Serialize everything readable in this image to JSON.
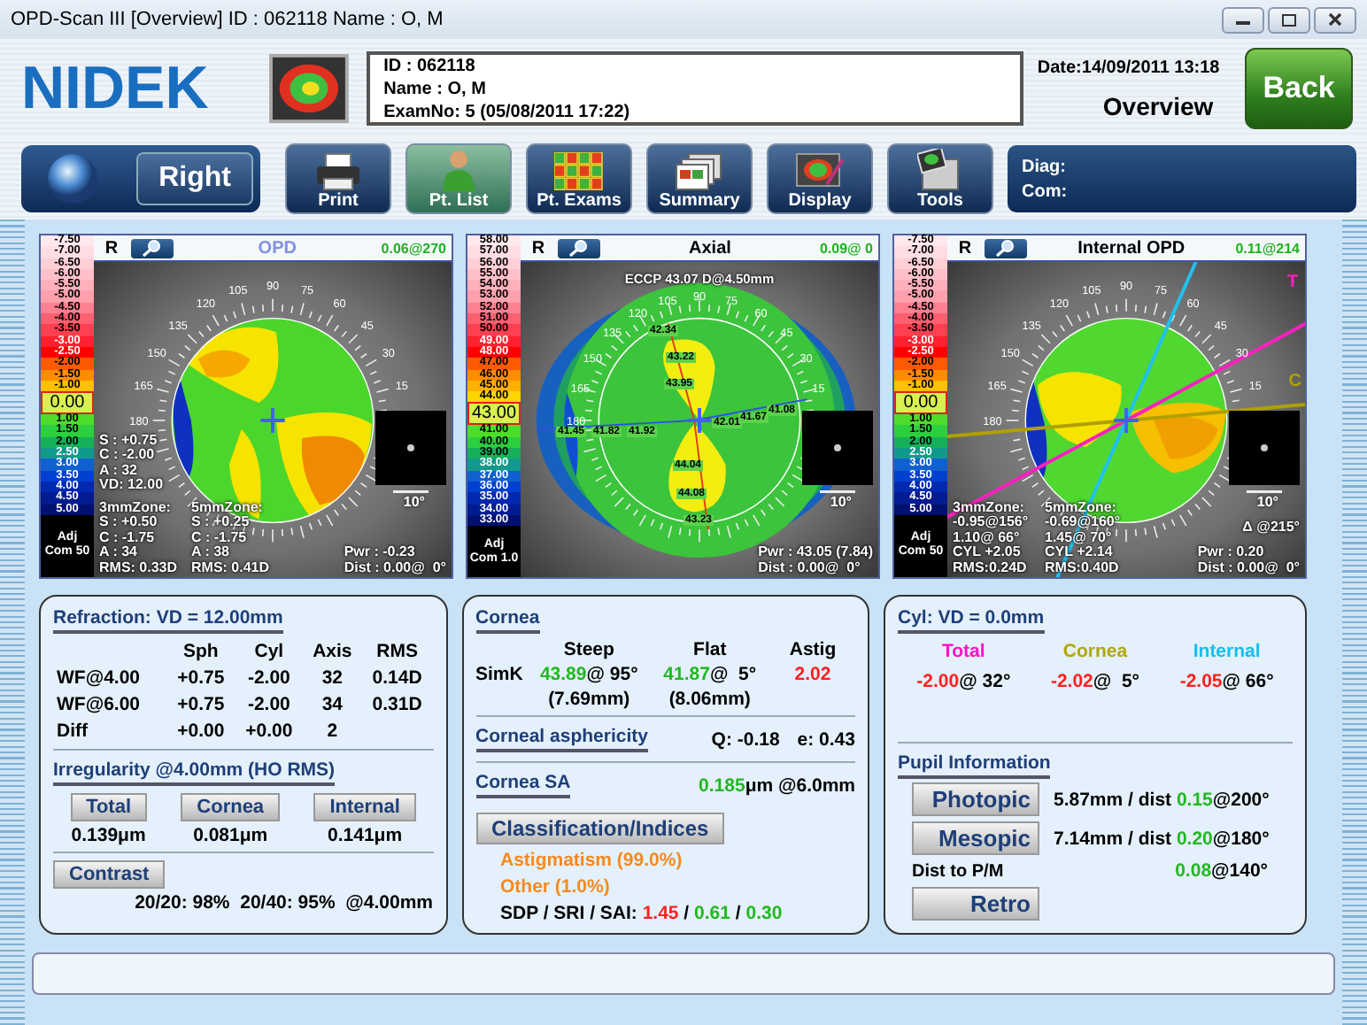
{
  "window": {
    "title": "OPD-Scan III  [Overview]  ID : 062118  Name : O,  M"
  },
  "header": {
    "logo": "NIDEK",
    "patient_lines": [
      "ID : 062118",
      "Name : O,  M",
      "ExamNo: 5 (05/08/2011 17:22)"
    ],
    "date": "Date:14/09/2011 13:18",
    "view": "Overview",
    "back_button": "Back"
  },
  "toolbar": {
    "eye_button": "Right",
    "buttons": [
      {
        "label": "Print",
        "selected": false
      },
      {
        "label": "Pt. List",
        "selected": true
      },
      {
        "label": "Pt. Exams",
        "selected": false
      },
      {
        "label": "Summary",
        "selected": false
      },
      {
        "label": "Display",
        "selected": false
      },
      {
        "label": "Tools",
        "selected": false
      }
    ],
    "diag_label": "Diag:",
    "com_label": "Com:"
  },
  "maps": [
    {
      "kind": "opd",
      "eye": "R",
      "title": "OPD",
      "reading": "0.06@270",
      "scale_top": [
        {
          "label": "-7.50",
          "color": "#ffe9ee"
        },
        {
          "label": "-7.00",
          "color": "#ffdde3"
        },
        {
          "label": "-6.50",
          "color": "#ffcfd6"
        },
        {
          "label": "-6.00",
          "color": "#ffc0c9"
        },
        {
          "label": "-5.50",
          "color": "#ffb0bb"
        },
        {
          "label": "-5.00",
          "color": "#ffa0ad"
        },
        {
          "label": "-4.50",
          "color": "#ff8090"
        },
        {
          "label": "-4.00",
          "color": "#ff6070"
        },
        {
          "label": "-3.50",
          "color": "#ff4050"
        },
        {
          "label": "-3.00",
          "color": "#ff2030"
        },
        {
          "label": "-2.50",
          "color": "#ff0000"
        },
        {
          "label": "-2.00",
          "color": "#ff5a00"
        },
        {
          "label": "-1.50",
          "color": "#ff8c00"
        },
        {
          "label": "-1.00",
          "color": "#ffc000"
        }
      ],
      "scale_current": "0.00",
      "scale_bottom": [
        {
          "label": "1.00",
          "color": "#4ede2a"
        },
        {
          "label": "1.50",
          "color": "#2ccf3e"
        },
        {
          "label": "2.00",
          "color": "#16b05a"
        },
        {
          "label": "2.50",
          "color": "#119a8c"
        },
        {
          "label": "3.00",
          "color": "#1060d0"
        },
        {
          "label": "3.50",
          "color": "#0040d0"
        },
        {
          "label": "4.00",
          "color": "#0028b0"
        },
        {
          "label": "4.50",
          "color": "#001c90"
        },
        {
          "label": "5.00",
          "color": "#001070"
        }
      ],
      "scale_footer": [
        "Adj",
        "Com 50"
      ],
      "dial_labels": [
        "15",
        "30",
        "45",
        "60",
        "75",
        "90",
        "105",
        "120",
        "135",
        "150",
        "165",
        "180"
      ],
      "summary": [
        "S : +0.75",
        "C : -2.00",
        "A : 32",
        "VD: 12.00"
      ],
      "zone3": [
        "3mmZone:",
        "S : +0.50",
        "C : -1.75",
        "A : 34",
        "RMS: 0.33D"
      ],
      "zone5": [
        "5mmZone:",
        "S : +0.25",
        "C : -1.75",
        "A : 38",
        "RMS: 0.41D"
      ],
      "power": [
        "Pwr : -0.23",
        "Dist : 0.00@  0°"
      ],
      "pupil_scale": "10°"
    },
    {
      "kind": "axial",
      "eye": "R",
      "title": "Axial",
      "reading": "0.09@  0",
      "scale_top": [
        {
          "label": "58.00",
          "color": "#ffe9ee"
        },
        {
          "label": "57.00",
          "color": "#ffdde3"
        },
        {
          "label": "56.00",
          "color": "#ffcfd6"
        },
        {
          "label": "55.00",
          "color": "#ffc0c9"
        },
        {
          "label": "54.00",
          "color": "#ffb0bb"
        },
        {
          "label": "53.00",
          "color": "#ffa0ad"
        },
        {
          "label": "52.00",
          "color": "#ff8090"
        },
        {
          "label": "51.00",
          "color": "#ff6070"
        },
        {
          "label": "50.00",
          "color": "#ff4050"
        },
        {
          "label": "49.00",
          "color": "#ff2030"
        },
        {
          "label": "48.00",
          "color": "#ff0000"
        },
        {
          "label": "47.00",
          "color": "#ff5a00"
        },
        {
          "label": "46.00",
          "color": "#ff8c00"
        },
        {
          "label": "45.00",
          "color": "#ffb000"
        },
        {
          "label": "44.00",
          "color": "#ffd400"
        }
      ],
      "scale_current": "43.00",
      "scale_bottom": [
        {
          "label": "41.00",
          "color": "#4ede2a"
        },
        {
          "label": "40.00",
          "color": "#2ccf3e"
        },
        {
          "label": "39.00",
          "color": "#16b05a"
        },
        {
          "label": "38.00",
          "color": "#119a8c"
        },
        {
          "label": "37.00",
          "color": "#1060d0"
        },
        {
          "label": "36.00",
          "color": "#0040d0"
        },
        {
          "label": "35.00",
          "color": "#0028b0"
        },
        {
          "label": "34.00",
          "color": "#001c90"
        },
        {
          "label": "33.00",
          "color": "#001070"
        }
      ],
      "scale_footer": [
        "Adj",
        "Com 1.0"
      ],
      "dial_labels": [
        "15",
        "30",
        "45",
        "60",
        "75",
        "90",
        "105",
        "120",
        "135",
        "150",
        "165",
        "180"
      ],
      "eccp": "ECCP 43.07 D@4.50mm",
      "power": [
        "Pwr : 43.05 (7.84)",
        "Dist : 0.00@  0°"
      ],
      "meridian_values": [
        "42.34",
        "43.22",
        "43.95",
        "41.45",
        "41.82",
        "41.92",
        "42.01",
        "41.67",
        "41.08",
        "44.04",
        "44.08",
        "43.23"
      ],
      "pupil_scale": "10°"
    },
    {
      "kind": "internal",
      "eye": "R",
      "title": "Internal OPD",
      "reading": "0.11@214",
      "scale_top": [
        {
          "label": "-7.50",
          "color": "#ffe9ee"
        },
        {
          "label": "-7.00",
          "color": "#ffdde3"
        },
        {
          "label": "-6.50",
          "color": "#ffcfd6"
        },
        {
          "label": "-6.00",
          "color": "#ffc0c9"
        },
        {
          "label": "-5.50",
          "color": "#ffb0bb"
        },
        {
          "label": "-5.00",
          "color": "#ffa0ad"
        },
        {
          "label": "-4.50",
          "color": "#ff8090"
        },
        {
          "label": "-4.00",
          "color": "#ff6070"
        },
        {
          "label": "-3.50",
          "color": "#ff4050"
        },
        {
          "label": "-3.00",
          "color": "#ff2030"
        },
        {
          "label": "-2.50",
          "color": "#ff0000"
        },
        {
          "label": "-2.00",
          "color": "#ff5a00"
        },
        {
          "label": "-1.50",
          "color": "#ff8c00"
        },
        {
          "label": "-1.00",
          "color": "#ffc000"
        }
      ],
      "scale_current": "0.00",
      "scale_bottom": [
        {
          "label": "1.00",
          "color": "#4ede2a"
        },
        {
          "label": "1.50",
          "color": "#2ccf3e"
        },
        {
          "label": "2.00",
          "color": "#16b05a"
        },
        {
          "label": "2.50",
          "color": "#119a8c"
        },
        {
          "label": "3.00",
          "color": "#1060d0"
        },
        {
          "label": "3.50",
          "color": "#0040d0"
        },
        {
          "label": "4.00",
          "color": "#0028b0"
        },
        {
          "label": "4.50",
          "color": "#001c90"
        },
        {
          "label": "5.00",
          "color": "#001070"
        }
      ],
      "scale_footer": [
        "Adj",
        "Com 50"
      ],
      "dial_labels": [
        "15",
        "30",
        "45",
        "60",
        "75",
        "90",
        "105",
        "120",
        "135",
        "150",
        "165",
        "180"
      ],
      "zone3": [
        "3mmZone:",
        "-0.95@156°",
        "1.10@ 66°",
        "CYL +2.05",
        "RMS:0.24D"
      ],
      "zone5": [
        "5mmZone:",
        "-0.69@160°",
        "1.45@ 70°",
        "CYL +2.14",
        "RMS:0.40D"
      ],
      "angle": "Δ @215°",
      "power": [
        "Pwr : 0.20",
        "Dist : 0.00@  0°"
      ],
      "axis_lines": [
        {
          "label": "T",
          "color": "#ff20c0"
        },
        {
          "label": "C",
          "color": "#b0a000"
        }
      ],
      "pupil_scale": "10°"
    }
  ],
  "refraction": {
    "title": "Refraction: VD = 12.00mm",
    "columns": [
      "Sph",
      "Cyl",
      "Axis",
      "RMS"
    ],
    "rows": [
      {
        "label": "WF@4.00",
        "cells": [
          "+0.75",
          "-2.00",
          "32",
          "0.14D"
        ]
      },
      {
        "label": "WF@6.00",
        "cells": [
          "+0.75",
          "-2.00",
          "34",
          "0.31D"
        ]
      },
      {
        "label": "Diff",
        "cells": [
          "+0.00",
          "+0.00",
          "2"
        ]
      }
    ]
  },
  "irregularity": {
    "title": "Irregularity @4.00mm (HO RMS)",
    "items": [
      {
        "button": "Total",
        "value": "0.139μm"
      },
      {
        "button": "Cornea",
        "value": "0.081μm"
      },
      {
        "button": "Internal",
        "value": "0.141μm"
      }
    ]
  },
  "contrast": {
    "button": "Contrast",
    "value": "20/20: 98%  20/40: 95%  @4.00mm"
  },
  "cornea": {
    "title": "Cornea",
    "columns": [
      "Steep",
      "Flat",
      "Astig"
    ],
    "row_label": "SimK",
    "steep": [
      {
        "text": "43.89",
        "color": "#22b822"
      },
      {
        "text": "@ 95°"
      }
    ],
    "steep_mm": "(7.69mm)",
    "flat": [
      {
        "text": "41.87",
        "color": "#22b822"
      },
      {
        "text": "@  5°"
      }
    ],
    "flat_mm": "(8.06mm)",
    "astig": [
      {
        "text": "2.02",
        "color": "#ff2020"
      }
    ]
  },
  "asphericity": {
    "title": "Corneal asphericity",
    "q": "Q: -0.18",
    "e": "e: 0.43"
  },
  "cornea_sa": {
    "title": "Cornea SA",
    "value": [
      {
        "text": "0.185",
        "color": "#22b822"
      },
      {
        "text": "μm @6.0mm"
      }
    ]
  },
  "classification": {
    "button": "Classification/Indices",
    "results": [
      "Astigmatism (99.0%)",
      "Other (1.0%)"
    ],
    "indices": [
      {
        "text": "SDP / SRI / SAI: "
      },
      {
        "text": "1.45",
        "color": "#ff2020"
      },
      {
        "text": " / "
      },
      {
        "text": "0.61",
        "color": "#22b822"
      },
      {
        "text": " / "
      },
      {
        "text": "0.30",
        "color": "#22b822"
      }
    ]
  },
  "cyl": {
    "title": "Cyl: VD = 0.0mm",
    "items": [
      {
        "label": "Total",
        "color": "#ff10c8",
        "value": [
          {
            "text": "-2.00",
            "color": "#ff2020"
          },
          {
            "text": "@ 32°"
          }
        ]
      },
      {
        "label": "Cornea",
        "color": "#b0a800",
        "value": [
          {
            "text": "-2.02",
            "color": "#ff2020"
          },
          {
            "text": "@  5°"
          }
        ]
      },
      {
        "label": "Internal",
        "color": "#10c0f0",
        "value": [
          {
            "text": "-2.05",
            "color": "#ff2020"
          },
          {
            "text": "@ 66°"
          }
        ]
      }
    ]
  },
  "pupil": {
    "title": "Pupil Information",
    "rows": [
      {
        "kind": "button",
        "label": "Photopic",
        "value": [
          {
            "text": "5.87mm / dist "
          },
          {
            "text": "0.15",
            "color": "#22b822"
          },
          {
            "text": "@200°"
          }
        ]
      },
      {
        "kind": "button",
        "label": "Mesopic",
        "value": [
          {
            "text": "7.14mm / dist "
          },
          {
            "text": "0.20",
            "color": "#22b822"
          },
          {
            "text": "@180°"
          }
        ]
      },
      {
        "kind": "text",
        "label": "Dist to P/M",
        "value": [
          {
            "text": "0.08",
            "color": "#22b822"
          },
          {
            "text": "@140°"
          }
        ]
      },
      {
        "kind": "button",
        "label": "Retro"
      }
    ]
  }
}
